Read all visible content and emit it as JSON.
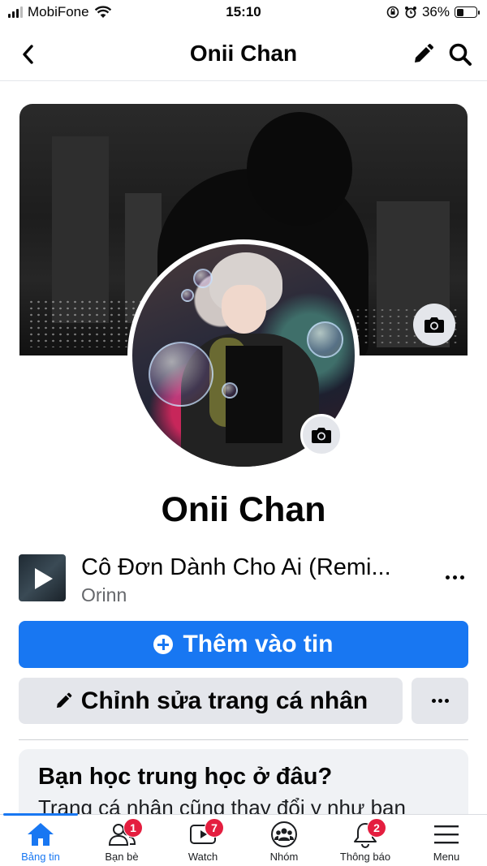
{
  "status_bar": {
    "carrier": "MobiFone",
    "time": "15:10",
    "battery": "36%",
    "battery_level": 0.36
  },
  "header": {
    "title": "Onii Chan",
    "back_icon": "chevron-left-icon",
    "edit_icon": "pencil-icon",
    "search_icon": "search-icon"
  },
  "profile": {
    "name": "Onii Chan"
  },
  "music": {
    "title": "Cô Đơn Dành Cho Ai (Remi...",
    "artist": "Orinn"
  },
  "actions": {
    "add_story": "Thêm vào tin",
    "edit_profile": "Chỉnh sửa trang cá nhân"
  },
  "card": {
    "title": "Bạn học trung học ở đâu?",
    "subtitle": "Trang cá nhân cũng thay đổi y như bạn"
  },
  "tabs": [
    {
      "label": "Bảng tin",
      "icon": "home-icon",
      "badge": ""
    },
    {
      "label": "Bạn bè",
      "icon": "friends-icon",
      "badge": "1"
    },
    {
      "label": "Watch",
      "icon": "video-icon",
      "badge": "7"
    },
    {
      "label": "Nhóm",
      "icon": "groups-icon",
      "badge": ""
    },
    {
      "label": "Thông báo",
      "icon": "bell-icon",
      "badge": "2"
    },
    {
      "label": "Menu",
      "icon": "menu-icon",
      "badge": ""
    }
  ],
  "colors": {
    "accent": "#1877f2",
    "badge": "#e41e3f",
    "button_gray": "#e4e6eb"
  }
}
